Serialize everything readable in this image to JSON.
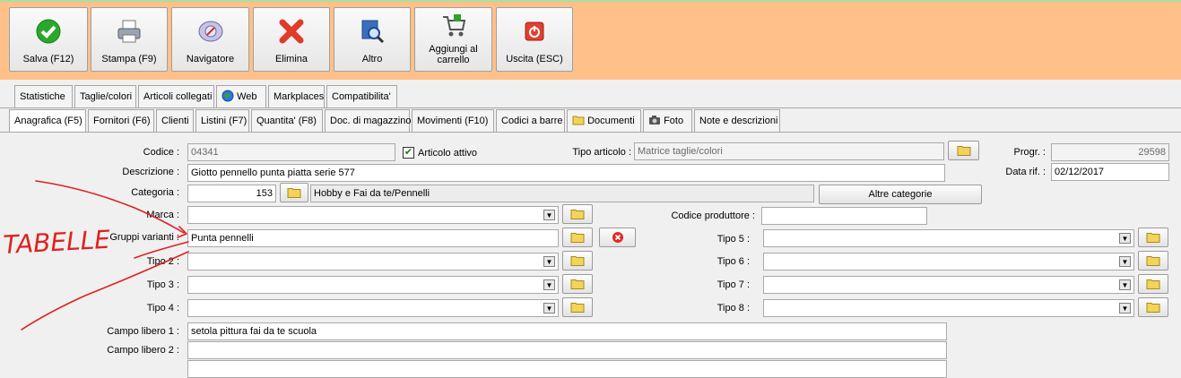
{
  "toolbar": {
    "save": "Salva (F12)",
    "print": "Stampa (F9)",
    "navigator": "Navigatore",
    "delete": "Elimina",
    "other": "Altro",
    "add_cart_1": "Aggiungi al",
    "add_cart_2": "carrello",
    "exit": "Uscita (ESC)"
  },
  "tabs_top": [
    "Statistiche",
    "Taglie/colori",
    "Articoli collegati",
    "Web",
    "Markplaces",
    "Compatibilita'"
  ],
  "tabs_main": [
    "Anagrafica (F5)",
    "Fornitori (F6)",
    "Clienti",
    "Listini (F7)",
    "Quantita' (F8)",
    "Doc. di magazzino",
    "Movimenti (F10)",
    "Codici a barre",
    "Documenti",
    "Foto",
    "Note e descrizioni"
  ],
  "form": {
    "codice_label": "Codice :",
    "codice_value": "04341",
    "attivo_label": "Articolo attivo",
    "tipo_articolo_label": "Tipo articolo :",
    "tipo_articolo_value": "Matrice taglie/colori",
    "progr_label": "Progr. :",
    "progr_value": "29598",
    "descrizione_label": "Descrizione :",
    "descrizione_value": "Giotto pennello punta piatta serie 577",
    "data_rif_label": "Data rif. :",
    "data_rif_value": "02/12/2017",
    "categoria_label": "Categoria :",
    "categoria_code": "153",
    "categoria_value": "Hobby e Fai da te/Pennelli",
    "altre_categorie": "Altre categorie",
    "marca_label": "Marca :",
    "codice_produttore_label": "Codice produttore :",
    "gruppi_varianti_label": "Gruppi varianti :",
    "gruppi_varianti_value": "Punta pennelli",
    "tipo2_label": "Tipo 2 :",
    "tipo3_label": "Tipo 3 :",
    "tipo4_label": "Tipo 4 :",
    "tipo5_label": "Tipo 5 :",
    "tipo6_label": "Tipo 6 :",
    "tipo7_label": "Tipo 7 :",
    "tipo8_label": "Tipo 8 :",
    "campo1_label": "Campo libero 1 :",
    "campo1_value": "setola pittura fai da te scuola",
    "campo2_label": "Campo libero 2 :"
  },
  "annotation": "TABELLE",
  "colors": {
    "toolbar_bg": "#ffc08a",
    "annotation": "#e02020"
  }
}
